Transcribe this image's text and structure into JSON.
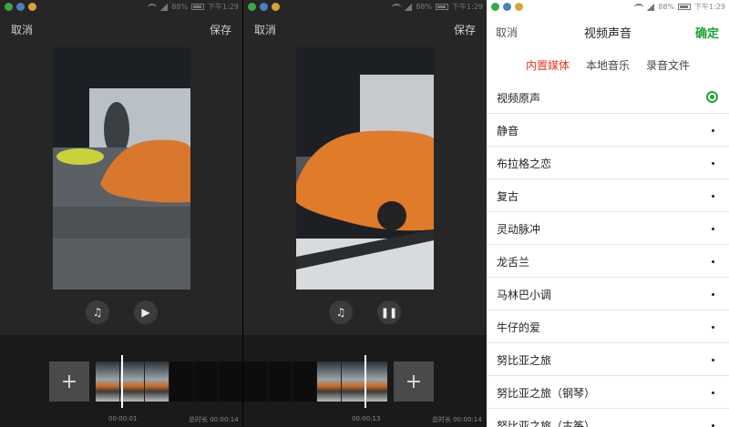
{
  "status": {
    "battery": "88%",
    "time": "下午1:29"
  },
  "editor1": {
    "cancel": "取消",
    "save": "保存",
    "current_time": "00:00:01",
    "total": "总时长 00:00:14"
  },
  "editor2": {
    "cancel": "取消",
    "save": "保存",
    "current_time": "00:00:13",
    "total": "总时长 00:00:14"
  },
  "music": {
    "cancel": "取消",
    "title": "视频声音",
    "confirm": "确定",
    "tabs": [
      "内置媒体",
      "本地音乐",
      "录音文件"
    ],
    "items": [
      "视频原声",
      "静音",
      "布拉格之恋",
      "复古",
      "灵动脉冲",
      "龙舌兰",
      "马林巴小调",
      "牛仔的爱",
      "努比亚之旅",
      "努比亚之旅（钢琴）",
      "努比亚之旅（古筝）"
    ]
  },
  "colors": {
    "accent_green": "#16a334",
    "tab_active": "#ee3322"
  },
  "icons": {
    "music": "music-note-icon",
    "play": "play-icon",
    "pause": "pause-icon",
    "add": "plus-icon"
  }
}
